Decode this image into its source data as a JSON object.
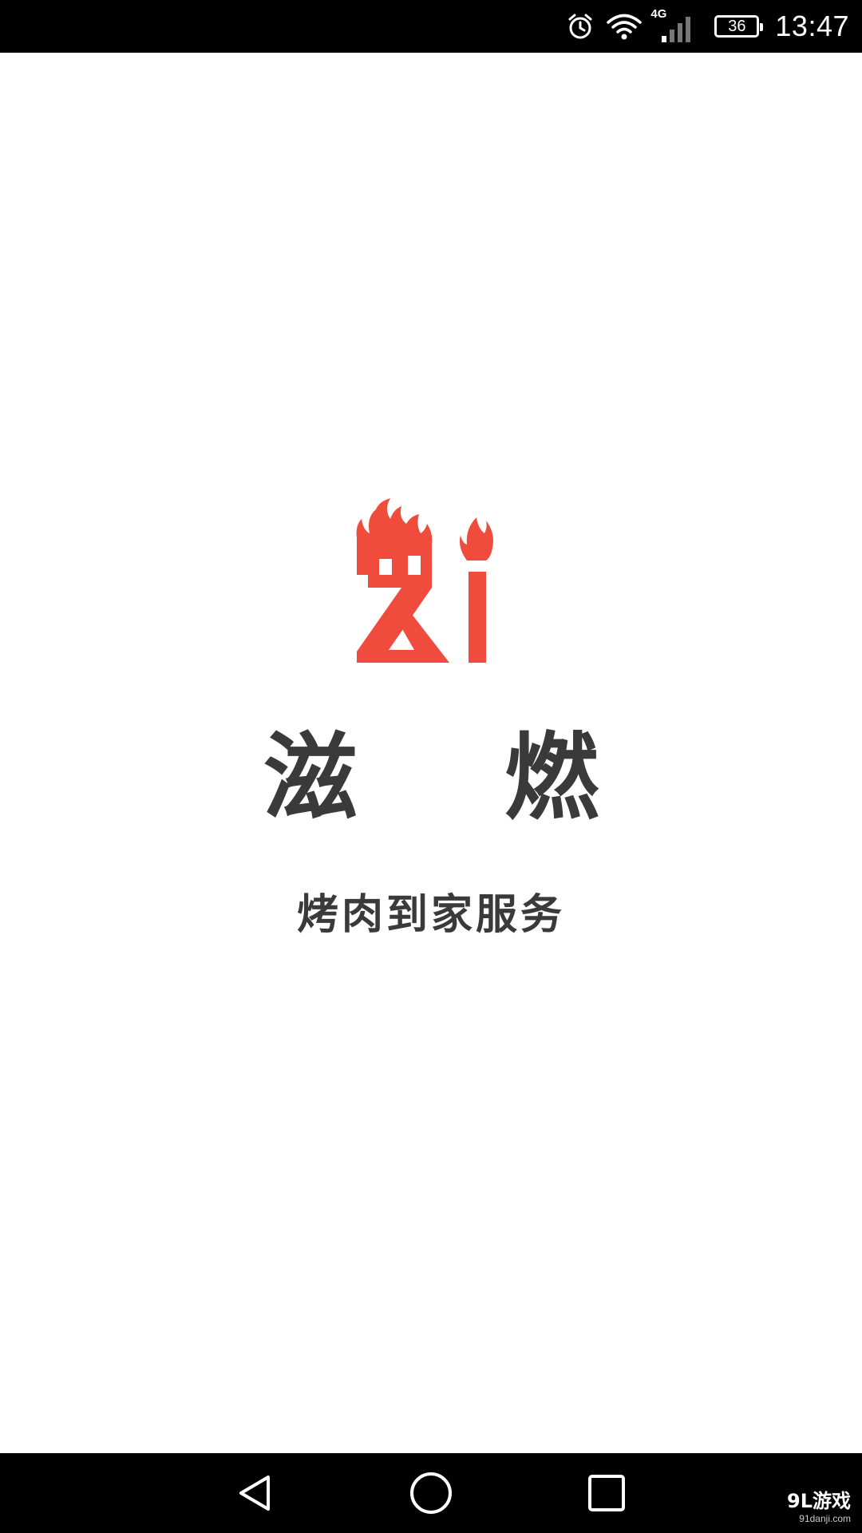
{
  "status_bar": {
    "network": "4G",
    "battery_level": "36",
    "time": "13:47",
    "icons": [
      "alarm-icon",
      "wifi-icon",
      "signal-icon",
      "battery-icon"
    ]
  },
  "splash": {
    "logo": "zi-flame-logo",
    "brand_char_1": "滋",
    "brand_char_2": "燃",
    "tagline": "烤肉到家服务"
  },
  "colors": {
    "accent": "#f04c3e",
    "text": "#3a3a3a",
    "bars": "#000000"
  },
  "nav_bar": {
    "icons": [
      "back-icon",
      "home-icon",
      "recents-icon"
    ]
  },
  "watermark": {
    "logo": "9L游戏",
    "url": "91danji.com"
  }
}
